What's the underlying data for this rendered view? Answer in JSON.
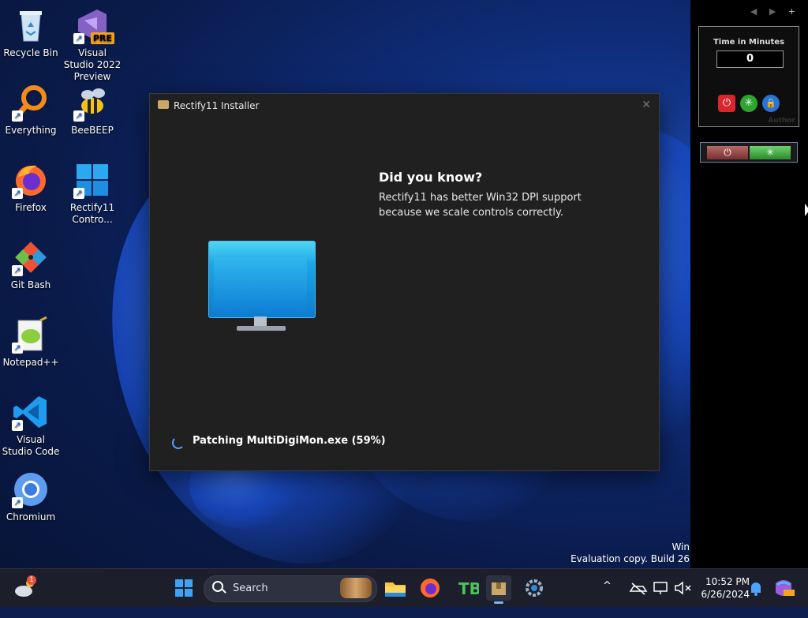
{
  "desktop": {
    "icons": [
      {
        "label": "Recycle Bin"
      },
      {
        "label": "Visual Studio 2022 Preview"
      },
      {
        "label": "Everything"
      },
      {
        "label": "BeeBEEP"
      },
      {
        "label": "Firefox"
      },
      {
        "label": "Rectify11 Contro..."
      },
      {
        "label": "Git Bash"
      },
      {
        "label": "Notepad++"
      },
      {
        "label": "Visual Studio Code"
      },
      {
        "label": "Chromium"
      }
    ],
    "vs_badge": "PRE"
  },
  "installer": {
    "title": "Rectify11 Installer",
    "close_glyph": "✕",
    "did_you_know_title": "Did you know?",
    "did_you_know_body": "Rectify11 has better Win32 DPI support because we scale controls correctly.",
    "progress_text": "Patching MultiDigiMon.exe (59%)",
    "progress_percent": 59
  },
  "gadgets": {
    "nav_glyphs": "◀ ▶",
    "add_glyph": "+",
    "timer": {
      "label": "Time in Minutes",
      "value": "0",
      "author": "Author"
    },
    "power_glyph": "⏻",
    "sleep_glyph": "✳",
    "lock_glyph": "🔒"
  },
  "watermark": {
    "line1": "Win",
    "line2": "Evaluation copy. Build 26"
  },
  "taskbar": {
    "search_placeholder": "Search",
    "weather_badge": "1",
    "time": "10:52 PM",
    "date": "6/26/2024",
    "chevron_glyph": "^"
  }
}
